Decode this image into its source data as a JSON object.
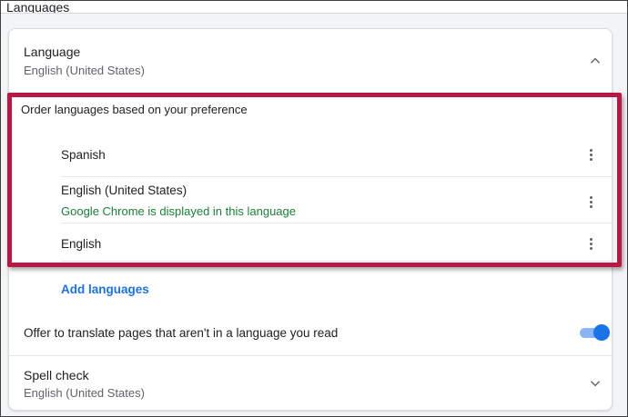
{
  "page": {
    "heading": "Languages"
  },
  "language_header": {
    "title": "Language",
    "subtitle": "English (United States)",
    "state": "expanded",
    "icon": "chevron-up-icon"
  },
  "order_section": {
    "label": "Order languages based on your preference",
    "languages": [
      {
        "name": "Spanish",
        "note": "",
        "menu_icon": "kebab-menu-icon"
      },
      {
        "name": "English (United States)",
        "note": "Google Chrome is displayed in this language",
        "menu_icon": "kebab-menu-icon"
      },
      {
        "name": "English",
        "note": "",
        "menu_icon": "kebab-menu-icon"
      }
    ],
    "add_link": "Add languages",
    "annotation": "red-highlight-rectangle"
  },
  "translate_row": {
    "label": "Offer to translate pages that aren't in a language you read",
    "toggle_on": true
  },
  "spell_check": {
    "title": "Spell check",
    "subtitle": "English (United States)",
    "state": "collapsed",
    "icon": "chevron-down-icon"
  },
  "colors": {
    "accent_blue": "#1a73e8",
    "toggle_track_blue": "#8ab4f8",
    "confirmation_green": "#188038",
    "annotation_red": "#bb1744",
    "text_primary": "#202124",
    "text_secondary": "#5f6368",
    "divider": "#e4e6e9",
    "page_background": "#f3f4f6"
  }
}
